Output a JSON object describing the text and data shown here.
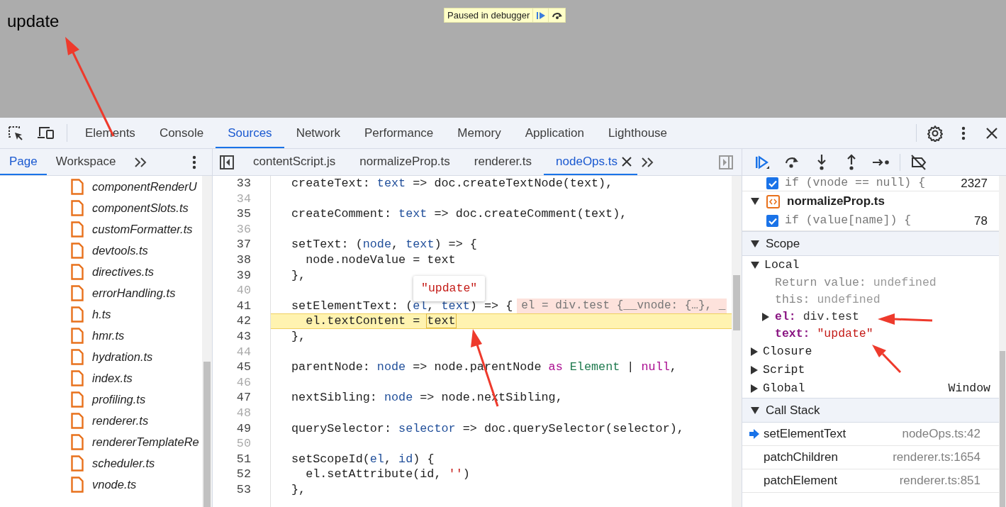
{
  "page": {
    "heading": "update",
    "paused_banner": {
      "text": "Paused in debugger"
    }
  },
  "main_tabs": [
    {
      "label": "Elements",
      "selected": false
    },
    {
      "label": "Console",
      "selected": false
    },
    {
      "label": "Sources",
      "selected": true
    },
    {
      "label": "Network",
      "selected": false
    },
    {
      "label": "Performance",
      "selected": false
    },
    {
      "label": "Memory",
      "selected": false
    },
    {
      "label": "Application",
      "selected": false
    },
    {
      "label": "Lighthouse",
      "selected": false
    }
  ],
  "navigator_tabs": [
    {
      "label": "Page",
      "selected": true
    },
    {
      "label": "Workspace",
      "selected": false
    }
  ],
  "files": [
    "componentRenderU",
    "componentSlots.ts",
    "customFormatter.ts",
    "devtools.ts",
    "directives.ts",
    "errorHandling.ts",
    "h.ts",
    "hmr.ts",
    "hydration.ts",
    "index.ts",
    "profiling.ts",
    "renderer.ts",
    "rendererTemplateRe",
    "scheduler.ts",
    "vnode.ts"
  ],
  "editor_tabs": [
    {
      "label": "contentScript.js",
      "selected": false
    },
    {
      "label": "normalizeProp.ts",
      "selected": false
    },
    {
      "label": "renderer.ts",
      "selected": false
    },
    {
      "label": "nodeOps.ts",
      "selected": true
    }
  ],
  "code_lines": [
    {
      "number": "33",
      "breakable": true,
      "tokens": [
        {
          "kind": "plain",
          "text": "createText: "
        },
        {
          "kind": "param",
          "text": "text"
        },
        {
          "kind": "plain",
          "text": " => doc.createTextNode(text),"
        }
      ]
    },
    {
      "number": "34",
      "breakable": false
    },
    {
      "number": "35",
      "breakable": true,
      "tokens": [
        {
          "kind": "plain",
          "text": "createComment: "
        },
        {
          "kind": "param",
          "text": "text"
        },
        {
          "kind": "plain",
          "text": " => doc.createComment(text),"
        }
      ]
    },
    {
      "number": "36",
      "breakable": false
    },
    {
      "number": "37",
      "breakable": true,
      "tokens": [
        {
          "kind": "plain",
          "text": "setText: ("
        },
        {
          "kind": "param",
          "text": "node"
        },
        {
          "kind": "plain",
          "text": ", "
        },
        {
          "kind": "param",
          "text": "text"
        },
        {
          "kind": "plain",
          "text": ") => {"
        }
      ]
    },
    {
      "number": "38",
      "breakable": true,
      "tokens": [
        {
          "kind": "plain",
          "text": "  node.nodeValue = text"
        }
      ]
    },
    {
      "number": "39",
      "breakable": true,
      "tokens": [
        {
          "kind": "plain",
          "text": "},"
        }
      ]
    },
    {
      "number": "40",
      "breakable": false
    },
    {
      "number": "41",
      "breakable": true,
      "tokens": [
        {
          "kind": "plain",
          "text": "setElementText: ("
        },
        {
          "kind": "param",
          "text": "el"
        },
        {
          "kind": "plain",
          "text": ", "
        },
        {
          "kind": "param",
          "text": "text"
        },
        {
          "kind": "plain",
          "text": ") => {"
        }
      ],
      "inline_value": "el = div.test {__vnode: {…}, _"
    },
    {
      "number": "42",
      "breakable": true,
      "paused": true,
      "tokens": [
        {
          "kind": "plain",
          "text": "  el.textContent = "
        },
        {
          "kind": "hovered",
          "text": "text"
        }
      ]
    },
    {
      "number": "43",
      "breakable": true,
      "tokens": [
        {
          "kind": "plain",
          "text": "},"
        }
      ]
    },
    {
      "number": "44",
      "breakable": false
    },
    {
      "number": "45",
      "breakable": true,
      "tokens": [
        {
          "kind": "plain",
          "text": "parentNode: "
        },
        {
          "kind": "param",
          "text": "node"
        },
        {
          "kind": "plain",
          "text": " => node.parentNode "
        },
        {
          "kind": "keyword",
          "text": "as "
        },
        {
          "kind": "type",
          "text": "Element"
        },
        {
          "kind": "plain",
          "text": " | "
        },
        {
          "kind": "keyword",
          "text": "null"
        },
        {
          "kind": "plain",
          "text": ","
        }
      ]
    },
    {
      "number": "46",
      "breakable": false
    },
    {
      "number": "47",
      "breakable": true,
      "tokens": [
        {
          "kind": "plain",
          "text": "nextSibling: "
        },
        {
          "kind": "param",
          "text": "node"
        },
        {
          "kind": "plain",
          "text": " => node.nextSibling,"
        }
      ]
    },
    {
      "number": "48",
      "breakable": false
    },
    {
      "number": "49",
      "breakable": true,
      "tokens": [
        {
          "kind": "plain",
          "text": "querySelector: "
        },
        {
          "kind": "param",
          "text": "selector"
        },
        {
          "kind": "plain",
          "text": " => doc.querySelector(selector),"
        }
      ]
    },
    {
      "number": "50",
      "breakable": false
    },
    {
      "number": "51",
      "breakable": true,
      "tokens": [
        {
          "kind": "plain",
          "text": "setScopeId("
        },
        {
          "kind": "param",
          "text": "el"
        },
        {
          "kind": "plain",
          "text": ", "
        },
        {
          "kind": "param",
          "text": "id"
        },
        {
          "kind": "plain",
          "text": ") {"
        }
      ]
    },
    {
      "number": "52",
      "breakable": true,
      "tokens": [
        {
          "kind": "plain",
          "text": "  el.setAttribute(id, "
        },
        {
          "kind": "string",
          "text": "''"
        },
        {
          "kind": "plain",
          "text": ")"
        }
      ]
    },
    {
      "number": "53",
      "breakable": true,
      "tokens": [
        {
          "kind": "plain",
          "text": "},"
        }
      ]
    }
  ],
  "hover_popup": {
    "text": "\"update\""
  },
  "breakpoints": [
    {
      "kind": "breakpoint",
      "code": "if (vnode == null) {",
      "line": "2327",
      "checked": true
    },
    {
      "kind": "file",
      "name": "normalizeProp.ts",
      "expanded": true
    },
    {
      "kind": "breakpoint",
      "code": "if (value[name]) {",
      "line": "78",
      "checked": true
    }
  ],
  "scope": {
    "label": "Scope",
    "expanded": true,
    "groups": [
      {
        "label": "Local",
        "expanded": true,
        "variables": [
          {
            "name": "Return value:",
            "value": "undefined",
            "kind": "special"
          },
          {
            "name": "this:",
            "value": "undefined",
            "kind": "special"
          },
          {
            "name": "el:",
            "value": "div.test",
            "kind": "object",
            "expanded": false
          },
          {
            "name": "text:",
            "value": "\"update\"",
            "kind": "string"
          }
        ]
      },
      {
        "label": "Closure",
        "expanded": false
      },
      {
        "label": "Script",
        "expanded": false
      },
      {
        "label": "Global",
        "expanded": false,
        "value": "Window"
      }
    ]
  },
  "call_stack": {
    "label": "Call Stack",
    "expanded": true,
    "frames": [
      {
        "name": "setElementText",
        "location": "nodeOps.ts:42",
        "selected": true
      },
      {
        "name": "patchChildren",
        "location": "renderer.ts:1654",
        "selected": false
      },
      {
        "name": "patchElement",
        "location": "renderer.ts:851",
        "selected": false
      }
    ]
  }
}
